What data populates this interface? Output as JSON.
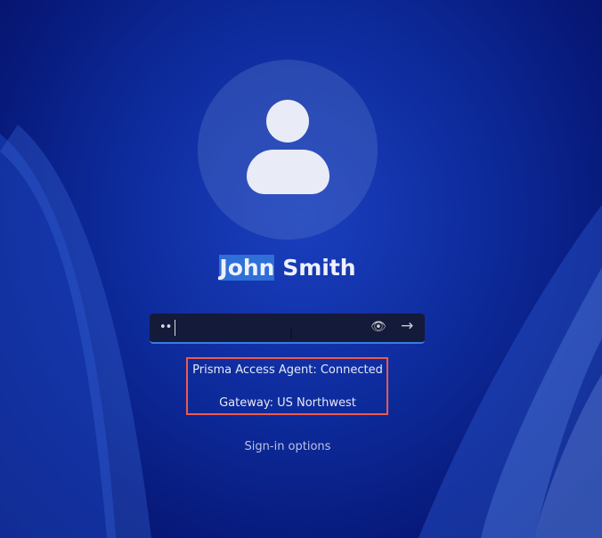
{
  "user": {
    "first_name": "John",
    "last_name": "Smith"
  },
  "password": {
    "masked_value": "••",
    "reveal_icon": "eye-icon",
    "submit_icon": "arrow-right-icon"
  },
  "status": {
    "agent": "Prisma Access Agent: Connected",
    "gateway": "Gateway: US Northwest"
  },
  "sign_in_options": "Sign-in options",
  "icons": {
    "eye": "👁",
    "arrow": "→",
    "ibeam": "I"
  }
}
